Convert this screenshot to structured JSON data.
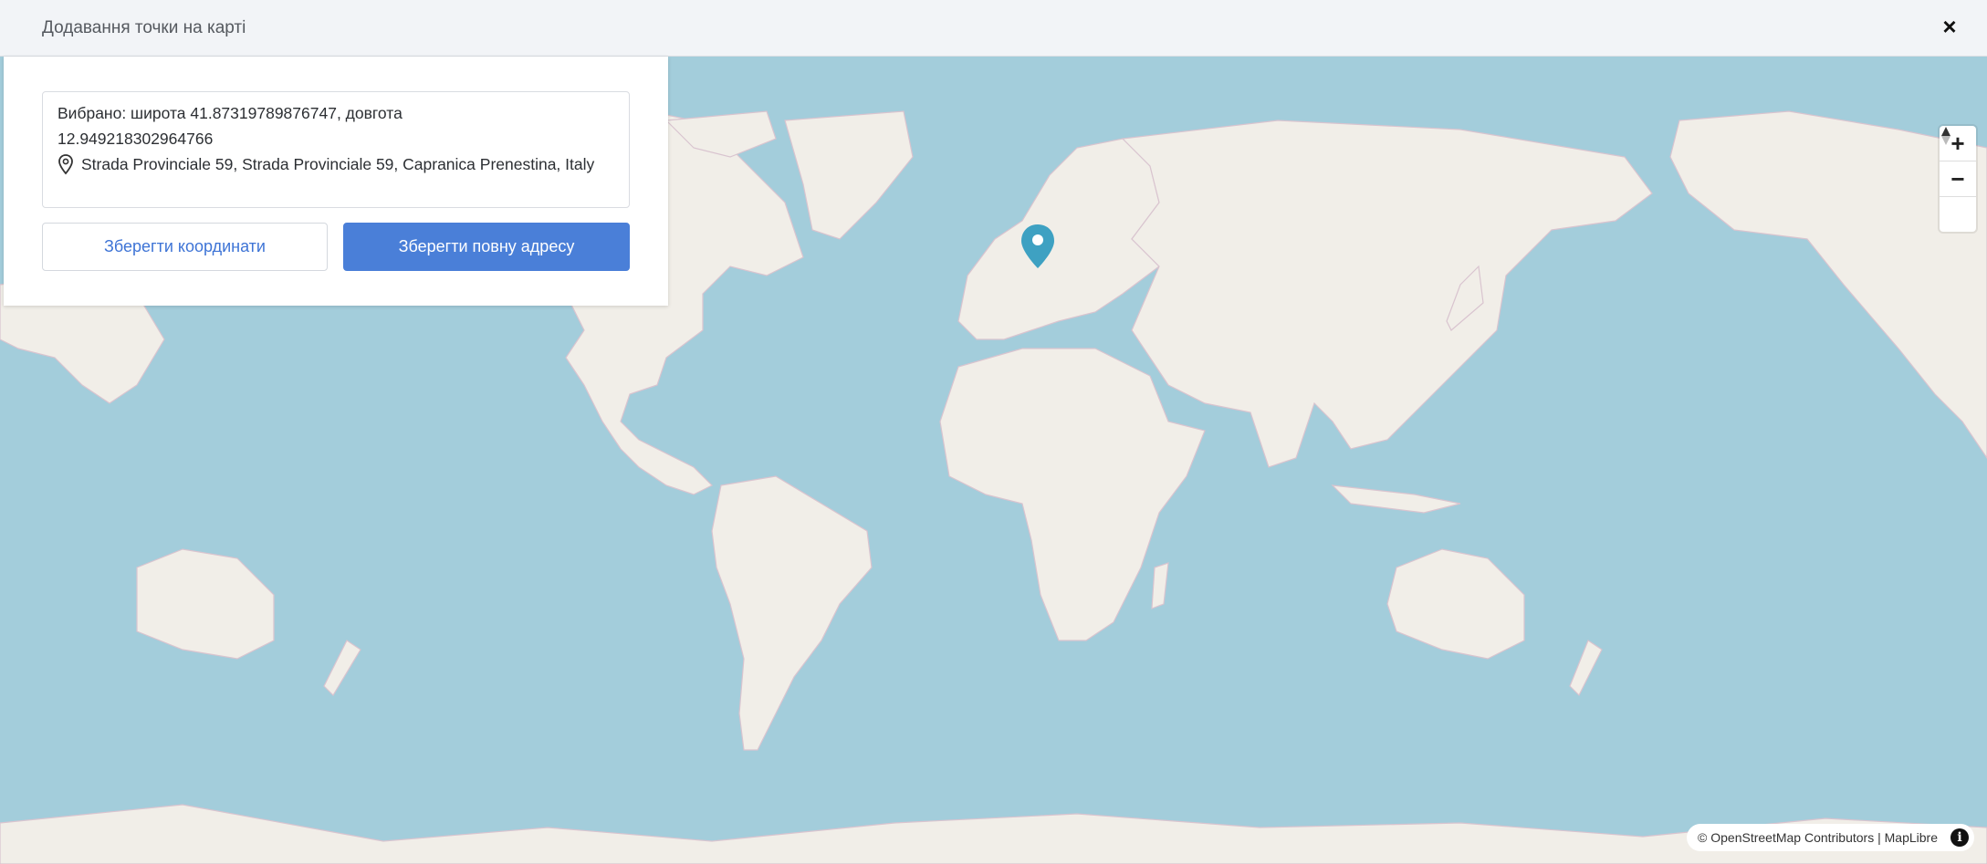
{
  "modal": {
    "title": "Додавання точки на карті",
    "close_label": "×"
  },
  "selection": {
    "coords_line1": "Вибрано: широта 41.87319789876747, довгота",
    "coords_line2": "12.949218302964766",
    "address": "Strada Provinciale 59, Strada Provinciale 59, Capranica Prenestina, Italy",
    "address_icon": "map-pin-icon"
  },
  "buttons": {
    "save_coords": "Зберегти координати",
    "save_full_address": "Зберегти повну адресу"
  },
  "map": {
    "zoom_in": "+",
    "zoom_out": "−",
    "compass": "compass-icon",
    "marker_icon": "map-marker-icon",
    "attribution": "© OpenStreetMap Contributors | MapLibre",
    "info": "i",
    "colors": {
      "water": "#a3cddb",
      "land": "#f1eee8",
      "border": "#d3b9c8",
      "marker": "#3ea1c2",
      "primary": "#4a7fd8"
    }
  }
}
